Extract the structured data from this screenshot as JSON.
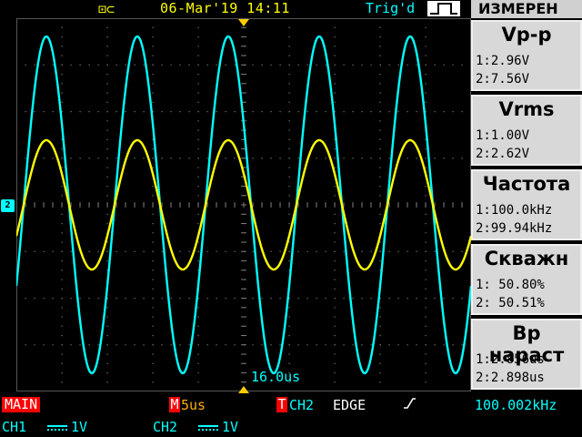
{
  "status_bar": {
    "usb_icon": "usb-icon",
    "date_time": "06-Mar'19 14:11",
    "trigger_status": "Trig'd",
    "trigger_edge_icon": "rising-edge-icon"
  },
  "display": {
    "channel_marker": "2",
    "time_offset": "16.0us",
    "colors": {
      "ch1": "#00ffff",
      "ch2": "#ffff00",
      "grid": "#7a7a7a"
    }
  },
  "menu": {
    "title": "ИЗМЕРЕН",
    "measurements": [
      {
        "name": "Vp-p",
        "line1": "1:2.96V",
        "line2": "2:7.56V"
      },
      {
        "name": "Vrms",
        "line1": "1:1.00V",
        "line2": "2:2.62V"
      },
      {
        "name": "Частота",
        "line1": "1:100.0kHz",
        "line2": "2:99.94kHz"
      },
      {
        "name": "Скважн",
        "line1": "1: 50.80%",
        "line2": "2: 50.51%"
      },
      {
        "name": "Вр нараст",
        "line1": "1:2.856us",
        "line2": "2:2.898us"
      }
    ]
  },
  "bottom": {
    "mode": "MAIN",
    "timebase_marker": "M",
    "timebase": "5us",
    "trigger_marker": "T",
    "trigger_source": "CH2",
    "trigger_type": "EDGE",
    "slope_icon": "rising-slope-icon",
    "frequency": "100.002kHz",
    "ch1_label": "CH1",
    "ch1_scale": "1V",
    "ch2_label": "CH2",
    "ch2_scale": "1V"
  }
}
